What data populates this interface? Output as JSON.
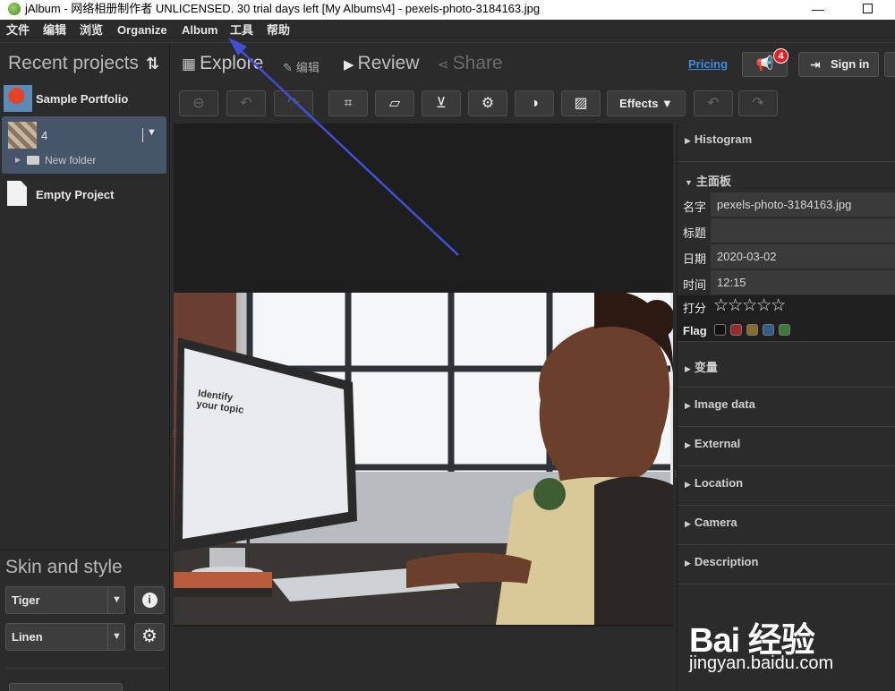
{
  "window": {
    "title": "jAlbum - 网络相册制作者 UNLICENSED. 30 trial days left [My Albums\\4] - pexels-photo-3184163.jpg",
    "minimize_glyph": "—",
    "maximize_glyph": ""
  },
  "menu": {
    "items": [
      {
        "label": "文件"
      },
      {
        "label": "编辑"
      },
      {
        "label": "浏览"
      },
      {
        "label": "Organize"
      },
      {
        "label": "Album"
      },
      {
        "label": "工具"
      },
      {
        "label": "帮助"
      }
    ]
  },
  "sidebar": {
    "recent_projects_title": "Recent projects",
    "sort_glyph": "⇅",
    "projects": [
      {
        "name": "Sample Portfolio"
      },
      {
        "name": "4",
        "child_folder": "New folder"
      },
      {
        "name": "Empty Project"
      }
    ],
    "skin_title": "Skin and style",
    "skin_value": "Tiger",
    "style_value": "Linen",
    "caret_glyph": "▼",
    "info_glyph": "i",
    "gear_glyph": "⚙"
  },
  "topbar": {
    "tabs": [
      {
        "label": "Explore",
        "icon": "grid-icon",
        "glyph": "▦"
      },
      {
        "label": "编辑",
        "icon": "pencil-icon",
        "glyph": "✎"
      },
      {
        "label": "Review",
        "icon": "play-icon",
        "glyph": "▶"
      },
      {
        "label": "Share",
        "icon": "share-icon",
        "glyph": "⋖"
      }
    ],
    "pricing_label": "Pricing",
    "notification_count": "4",
    "notification_glyph": "📢",
    "signin_label": "Sign in",
    "signin_glyph": "⇥"
  },
  "toolbar": {
    "buttons": [
      {
        "name": "remove",
        "glyph": "⊖",
        "enabled": false
      },
      {
        "name": "rotate-left",
        "glyph": "↶",
        "enabled": false
      },
      {
        "name": "rotate-right",
        "glyph": "↷",
        "enabled": false
      },
      {
        "name": "crop",
        "glyph": "⌗",
        "enabled": true
      },
      {
        "name": "straighten",
        "glyph": "▱",
        "enabled": true
      },
      {
        "name": "perspective",
        "glyph": "⊻",
        "enabled": true
      },
      {
        "name": "settings",
        "glyph": "⚙",
        "enabled": true
      },
      {
        "name": "contrast",
        "glyph": "◑",
        "enabled": true
      },
      {
        "name": "image-adjust",
        "glyph": "▨",
        "enabled": true
      },
      {
        "name": "undo",
        "glyph": "↶",
        "enabled": false
      },
      {
        "name": "redo",
        "glyph": "↷",
        "enabled": false
      }
    ],
    "effects_label": "Effects ▼"
  },
  "photo": {
    "screen_line1": "Identify",
    "screen_line2": "your topic"
  },
  "rightpanel": {
    "sections_top": [
      {
        "label": "Histogram",
        "caret": "▶"
      },
      {
        "label": "主面板",
        "caret": "▼"
      }
    ],
    "fields": [
      {
        "label": "名字",
        "value": "pexels-photo-3184163.jpg"
      },
      {
        "label": "标题",
        "value": ""
      },
      {
        "label": "日期",
        "value": "2020-03-02"
      },
      {
        "label": "时间",
        "value": "12:15"
      }
    ],
    "rating_label": "打分",
    "rating_value": 0,
    "rating_max": 5,
    "stars_display": "☆☆☆☆☆",
    "flag_label": "Flag",
    "flag_colors": [
      "#111111",
      "#9b2a2a",
      "#8a6a2a",
      "#2f5f8a",
      "#3a7a3a"
    ],
    "sections_bottom": [
      {
        "label": "变量",
        "caret": "▶"
      },
      {
        "label": "Image data",
        "caret": "▶"
      },
      {
        "label": "External",
        "caret": "▶"
      },
      {
        "label": "Location",
        "caret": "▶"
      },
      {
        "label": "Camera",
        "caret": "▶"
      },
      {
        "label": "Description",
        "caret": "▶"
      }
    ]
  },
  "watermark": {
    "brand": "Bai 经验",
    "url": "jingyan.baidu.com"
  }
}
